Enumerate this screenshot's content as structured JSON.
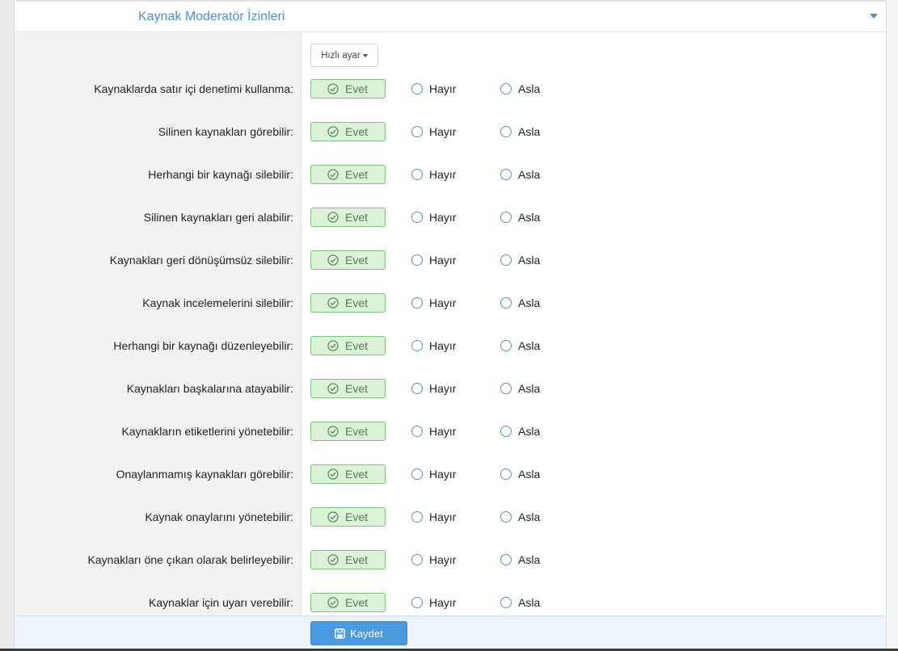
{
  "section": {
    "title": "Kaynak Moderatör İzinleri",
    "collapse_icon": "caret-down-icon"
  },
  "quick_set": {
    "label": "Hızlı ayar"
  },
  "options": {
    "yes": "Evet",
    "no": "Hayır",
    "never": "Asla"
  },
  "permissions": [
    {
      "label": "Kaynaklarda satır içi denetimi kullanma:",
      "selected": "yes"
    },
    {
      "label": "Silinen kaynakları görebilir:",
      "selected": "yes"
    },
    {
      "label": "Herhangi bir kaynağı silebilir:",
      "selected": "yes"
    },
    {
      "label": "Silinen kaynakları geri alabilir:",
      "selected": "yes"
    },
    {
      "label": "Kaynakları geri dönüşümsüz silebilir:",
      "selected": "yes"
    },
    {
      "label": "Kaynak incelemelerini silebilir:",
      "selected": "yes"
    },
    {
      "label": "Herhangi bir kaynağı düzenleyebilir:",
      "selected": "yes"
    },
    {
      "label": "Kaynakları başkalarına atayabilir:",
      "selected": "yes"
    },
    {
      "label": "Kaynakların etiketlerini yönetebilir:",
      "selected": "yes"
    },
    {
      "label": "Onaylanmamış kaynakları görebilir:",
      "selected": "yes"
    },
    {
      "label": "Kaynak onaylarını yönetebilir:",
      "selected": "yes"
    },
    {
      "label": "Kaynakları öne çıkan olarak belirleyebilir:",
      "selected": "yes"
    },
    {
      "label": "Kaynaklar için uyarı verebilir:",
      "selected": "yes"
    }
  ],
  "footer": {
    "save_label": "Kaydet",
    "save_icon": "floppy-disk-icon"
  },
  "colors": {
    "accent": "#4a8fd0",
    "yes_selected_bg": "#dcf2d8",
    "yes_selected_border": "#7cc47a",
    "save_button": "#4a9ae0"
  }
}
